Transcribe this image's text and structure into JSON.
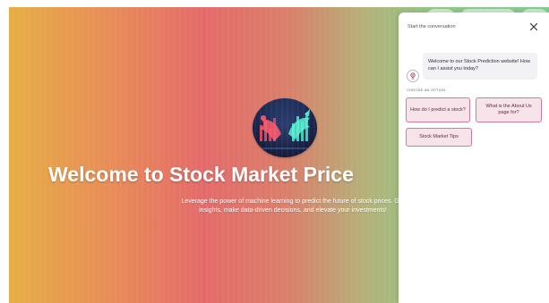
{
  "hero": {
    "title": "Welcome to Stock Market Price",
    "subtitle": "Leverage the power of machine learning to predict the future of stock prices. Get insights, make data-driven decisions, and elevate your investments!",
    "logo_icon": "bull-bear-chart-icon"
  },
  "chat": {
    "header_title": "Start the conversation",
    "close_icon": "close-icon",
    "bot_avatar_icon": "bot-avatar-icon",
    "bot_message": "Welcome to our Stock Prediction website! How can I assist you today?",
    "options_label": "CHOOSE AN OPTION",
    "options": [
      {
        "label": "How do I predict a stock?"
      },
      {
        "label": "What is the About Us page for?"
      },
      {
        "label": "Stock Market Tips"
      }
    ]
  },
  "colors": {
    "option_border": "#d27b98",
    "option_bg": "#f7e3ea",
    "gradient_left": "#e6ae45",
    "gradient_mid": "#e46a6a",
    "gradient_right": "#7ecb8f"
  }
}
